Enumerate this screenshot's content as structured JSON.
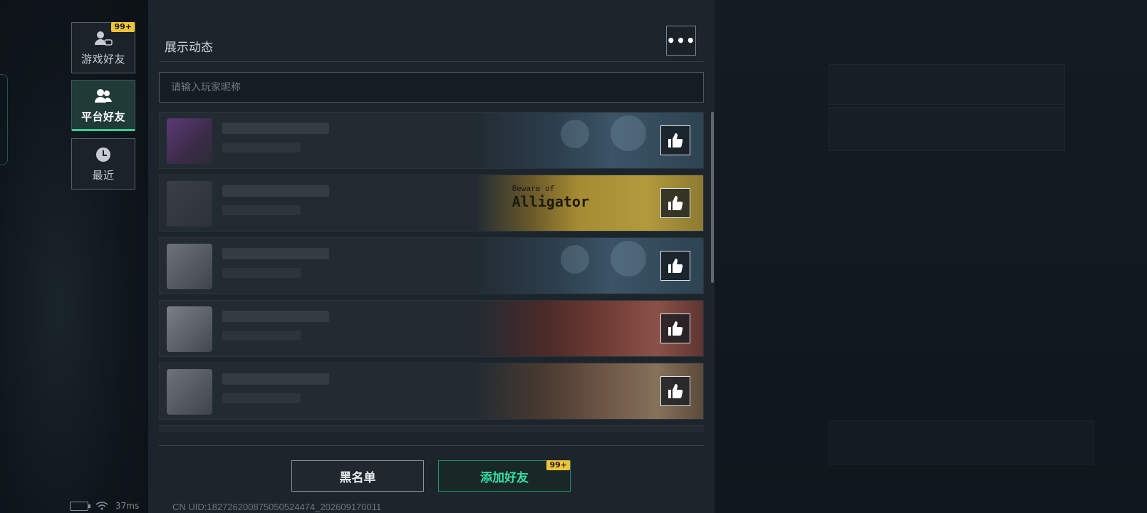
{
  "sidebar": {
    "tabs": [
      {
        "label": "游戏好友",
        "icon": "game-friends-icon",
        "badge": "99+"
      },
      {
        "label": "平台好友",
        "icon": "platform-friends-icon",
        "active": true
      },
      {
        "label": "最近",
        "icon": "clock-icon"
      }
    ]
  },
  "status_bar": {
    "battery_icon": "battery-charging-icon",
    "wifi_icon": "wifi-icon",
    "latency": "37ms"
  },
  "panel": {
    "title": "展示动态",
    "more_label": "•••",
    "search_placeholder": "请输入玩家昵称",
    "friends": [
      {
        "banner": "skeleton-banner"
      },
      {
        "banner": "alligator-banner",
        "banner_title": "Alligator",
        "banner_subtitle": "Beware of"
      },
      {
        "banner": "skeleton-banner"
      },
      {
        "banner": "red-festival-banner"
      },
      {
        "banner": "anime-banner"
      }
    ],
    "like_icon": "thumbs-up-icon",
    "buttons": {
      "blacklist": "黑名单",
      "add_friend": "添加好友",
      "add_friend_badge": "99+"
    },
    "uid": "CN UID:1827262008750505244​74_202609170011"
  },
  "colors": {
    "accent": "#2fd09a",
    "badge": "#f0c43a",
    "panel_bg": "#1d252c"
  }
}
